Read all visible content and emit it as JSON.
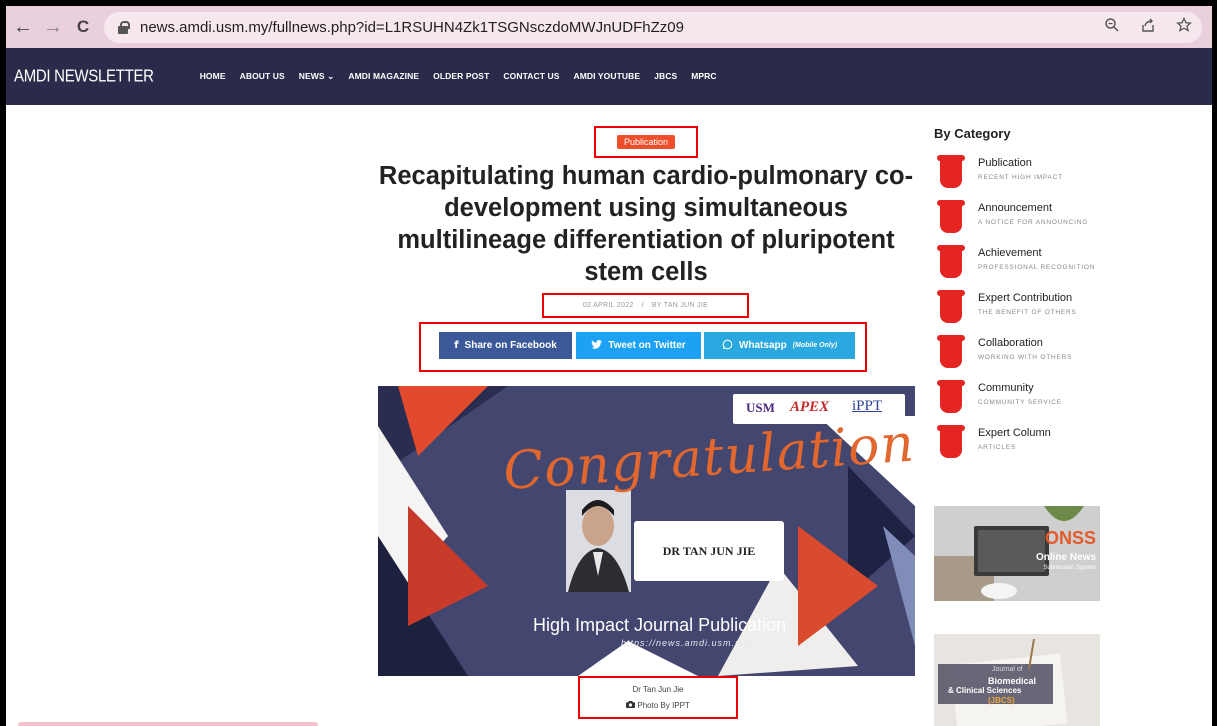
{
  "browser": {
    "back": "←",
    "forward": "→",
    "reload": "C",
    "url": "news.amdi.usm.my/fullnews.php?id=L1RSUHN4Zk1TSGNsczdoMWJnUDFhZz09",
    "icons": [
      "zoom-icon",
      "share-icon",
      "star-icon"
    ]
  },
  "header": {
    "brand": "AMDI NEWSLETTER",
    "menu": [
      "HOME",
      "ABOUT US",
      "NEWS ⌄",
      "AMDI MAGAZINE",
      "OLDER POST",
      "CONTACT US",
      "AMDI YOUTUBE",
      "JBCS",
      "MPRC"
    ]
  },
  "article": {
    "category": "Publication",
    "title": "Recapitulating human cardio-pulmonary co-development using simultaneous multilineage differentiation of pluripotent stem cells",
    "date": "02 APRIL 2022",
    "separator": "/",
    "author": "BY TAN JUN JIE",
    "share": {
      "facebook": "Share on Facebook",
      "twitter": "Tweet on Twitter",
      "whatsapp": "Whatsapp",
      "whatsapp_note": "(Mobile Only)"
    },
    "hero": {
      "congrats": "Congratulations!",
      "name": "DR TAN JUN JIE",
      "headline": "High Impact Journal Publication",
      "link": "https://news.amdi.usm.my/",
      "logos": [
        "USM",
        "APEX",
        "iPPT"
      ]
    },
    "caption": "Dr Tan Jun Jie",
    "photo_credit": "Photo By IPPT"
  },
  "sidebar": {
    "title": "By Category",
    "categories": [
      {
        "name": "Publication",
        "sub": "RECENT HIGH IMPACT"
      },
      {
        "name": "Announcement",
        "sub": "A NOTICE FOR ANNOUNCING"
      },
      {
        "name": "Achievement",
        "sub": "PROFESSIONAL RECOGNITION"
      },
      {
        "name": "Expert Contribution",
        "sub": "THE BENEFIT OF OTHERS"
      },
      {
        "name": "Collaboration",
        "sub": "WORKING WITH OTHERS"
      },
      {
        "name": "Community",
        "sub": "COMMUNITY SERVICE"
      },
      {
        "name": "Expert Column",
        "sub": "ARTICLES"
      }
    ],
    "ad_onss": {
      "title": "ONSS",
      "line1": "Online News",
      "line2": "Submission System"
    },
    "ad_jbcs": {
      "line1": "Journal of",
      "line2": "Biomedical",
      "line3": "& Clinical Sciences",
      "line4": "(JBCS)"
    }
  },
  "colors": {
    "accent": "#ee4f2a",
    "header": "#2a2b4a",
    "highlight": "#e00000"
  }
}
